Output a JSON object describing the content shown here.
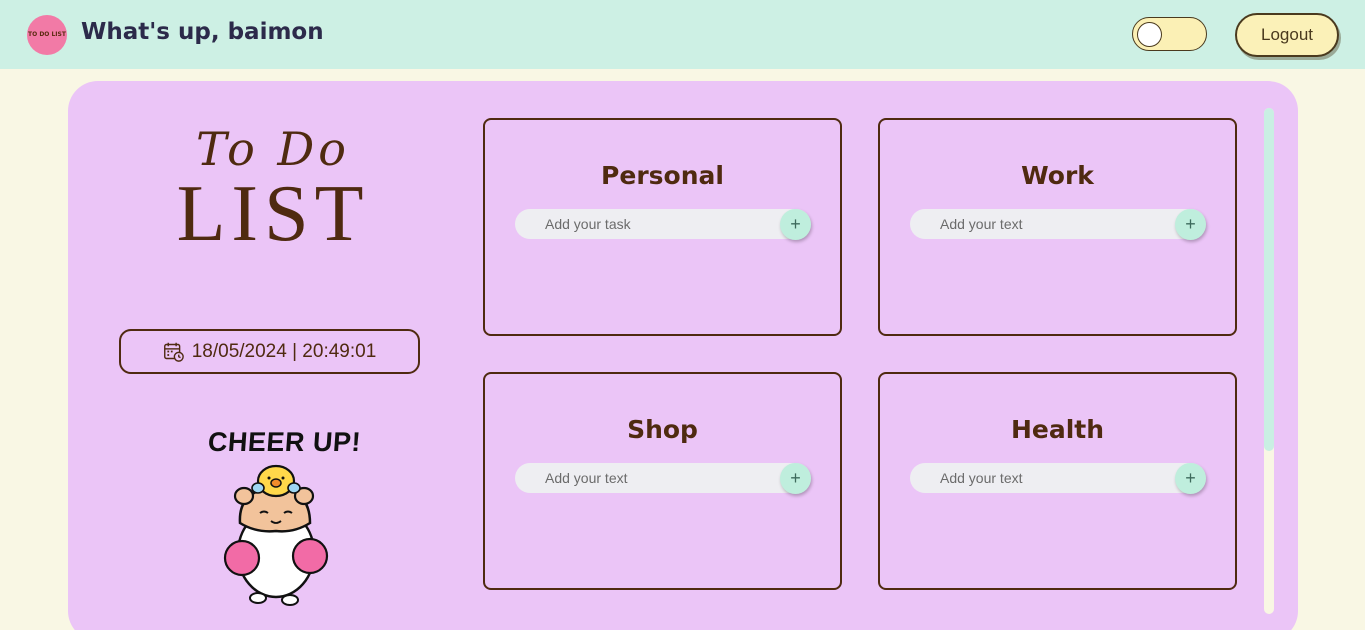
{
  "header": {
    "logo_text": "TO DO LIST",
    "greeting": "What's up, baimon",
    "logout_label": "Logout"
  },
  "sidebar": {
    "title_line1": "To Do",
    "title_line2": "LIST",
    "datetime": "18/05/2024 | 20:49:01",
    "sticker_text": "CHEER UP!"
  },
  "cards": [
    {
      "title": "Personal",
      "placeholder": "Add your task",
      "add_label": "+"
    },
    {
      "title": "Work",
      "placeholder": "Add your text",
      "add_label": "+"
    },
    {
      "title": "Shop",
      "placeholder": "Add your text",
      "add_label": "+"
    },
    {
      "title": "Health",
      "placeholder": "Add your text",
      "add_label": "+"
    }
  ],
  "theme": {
    "header_bg": "#cdf0e4",
    "panel_bg": "#ebc5f7",
    "page_bg": "#f9f7e4",
    "text_brown": "#4f2a10",
    "add_button": "#bfeedd"
  },
  "icons": [
    "calendar-clock-icon",
    "plus-icon"
  ]
}
